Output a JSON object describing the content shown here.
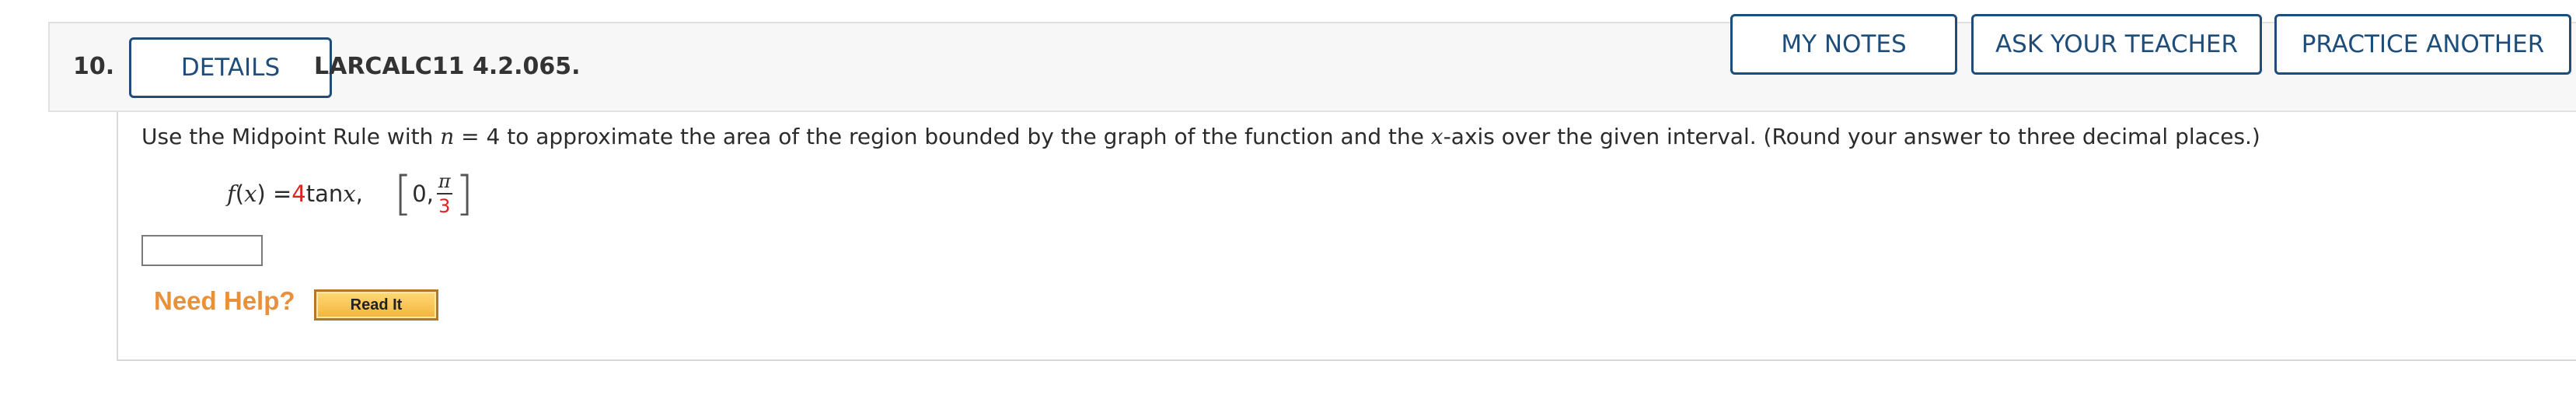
{
  "header": {
    "number": "10.",
    "details_label": "DETAILS",
    "code": "LARCALC11 4.2.065.",
    "my_notes_label": "MY NOTES",
    "ask_teacher_label": "ASK YOUR TEACHER",
    "practice_another_label": "PRACTICE ANOTHER"
  },
  "question": {
    "prompt_before_n": "Use the Midpoint Rule with ",
    "n_var": "n",
    "prompt_n_value": " = 4 to approximate the area of the region bounded by the graph of the function and the ",
    "x_var": "x",
    "prompt_after_x": "-axis over the given interval. (Round your answer to three decimal places.)",
    "formula": {
      "f": "f",
      "open_paren": "(",
      "x": "x",
      "close_eq": ") = ",
      "coefficient": "4",
      "func": " tan ",
      "arg": "x",
      "comma": ",",
      "interval_left_bracket": "[",
      "interval_start": "0,",
      "interval_numerator": "π",
      "interval_denominator": "3",
      "interval_right_bracket": "]"
    },
    "answer_value": "",
    "answer_placeholder": ""
  },
  "help": {
    "label": "Need Help?",
    "read_it_label": "Read It"
  },
  "colors": {
    "button_blue": "#1f4d7a",
    "highlight_red": "#e0221f",
    "help_orange": "#e8913a"
  }
}
